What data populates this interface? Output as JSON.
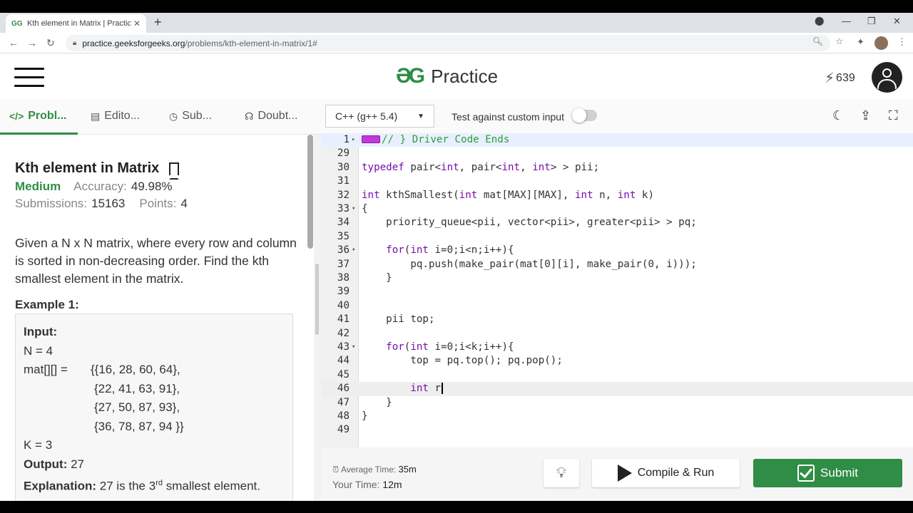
{
  "browser": {
    "tab_title": "Kth element in Matrix | Practice |",
    "tab_favicon": "GG",
    "url_host": "practice.geeksforgeeks.org",
    "url_path": "/problems/kth-element-in-matrix/1#"
  },
  "header": {
    "logo_text": "Practice",
    "streak": "639"
  },
  "problem_tabs": [
    {
      "label": "Probl...",
      "icon": "code-icon"
    },
    {
      "label": "Edito...",
      "icon": "document-icon"
    },
    {
      "label": "Sub...",
      "icon": "clock-icon"
    },
    {
      "label": "Doubt...",
      "icon": "headset-icon"
    }
  ],
  "editor_bar": {
    "language": "C++ (g++ 5.4)",
    "custom_input_label": "Test against custom input"
  },
  "problem": {
    "title": "Kth element in Matrix",
    "difficulty": "Medium",
    "accuracy_label": "Accuracy:",
    "accuracy": "49.98%",
    "submissions_label": "Submissions:",
    "submissions": "15163",
    "points_label": "Points:",
    "points": "4",
    "description": "Given a N x N matrix, where every row and column is sorted in non-decreasing order. Find the kth smallest element in the matrix.",
    "example_heading": "Example 1:",
    "example": {
      "input_label": "Input:",
      "n_line": "N = 4",
      "mat_label": "mat[][] =",
      "mat_rows": [
        "{{16, 28, 60, 64},",
        "{22, 41, 63, 91},",
        "{27, 50, 87, 93},",
        "{36, 78, 87, 94 }}"
      ],
      "k_line": "K = 3",
      "output_label": "Output:",
      "output_value": "27",
      "explanation_label": "Explanation:",
      "explanation_pre": "27 is the 3",
      "explanation_sup": "rd",
      "explanation_post": " smallest element."
    }
  },
  "code_lines": [
    {
      "n": "1",
      "fold": true,
      "text": "// } Driver Code Ends"
    },
    {
      "n": "29",
      "text": ""
    },
    {
      "n": "30",
      "text": "typedef pair<int, pair<int, int> > pii;"
    },
    {
      "n": "31",
      "text": ""
    },
    {
      "n": "32",
      "text": "int kthSmallest(int mat[MAX][MAX], int n, int k)"
    },
    {
      "n": "33",
      "fold": true,
      "text": "{"
    },
    {
      "n": "34",
      "text": "    priority_queue<pii, vector<pii>, greater<pii> > pq;"
    },
    {
      "n": "35",
      "text": ""
    },
    {
      "n": "36",
      "fold": true,
      "text": "    for(int i=0;i<n;i++){"
    },
    {
      "n": "37",
      "text": "        pq.push(make_pair(mat[0][i], make_pair(0, i)));"
    },
    {
      "n": "38",
      "text": "    }"
    },
    {
      "n": "39",
      "text": ""
    },
    {
      "n": "40",
      "text": ""
    },
    {
      "n": "41",
      "text": "    pii top;"
    },
    {
      "n": "42",
      "text": ""
    },
    {
      "n": "43",
      "fold": true,
      "text": "    for(int i=0;i<k;i++){"
    },
    {
      "n": "44",
      "text": "        top = pq.top(); pq.pop();"
    },
    {
      "n": "45",
      "text": ""
    },
    {
      "n": "46",
      "text": "        int r",
      "current": true
    },
    {
      "n": "47",
      "text": "    }"
    },
    {
      "n": "48",
      "text": "}"
    },
    {
      "n": "49",
      "text": ""
    }
  ],
  "footer": {
    "avg_time_label": "Average Time:",
    "avg_time": "35m",
    "your_time_label": "Your Time:",
    "your_time": "12m",
    "compile_label": "Compile & Run",
    "submit_label": "Submit"
  },
  "colors": {
    "brand_green": "#2f8d46",
    "keyword": "#7a0dad",
    "comment": "#2e9b3b"
  }
}
